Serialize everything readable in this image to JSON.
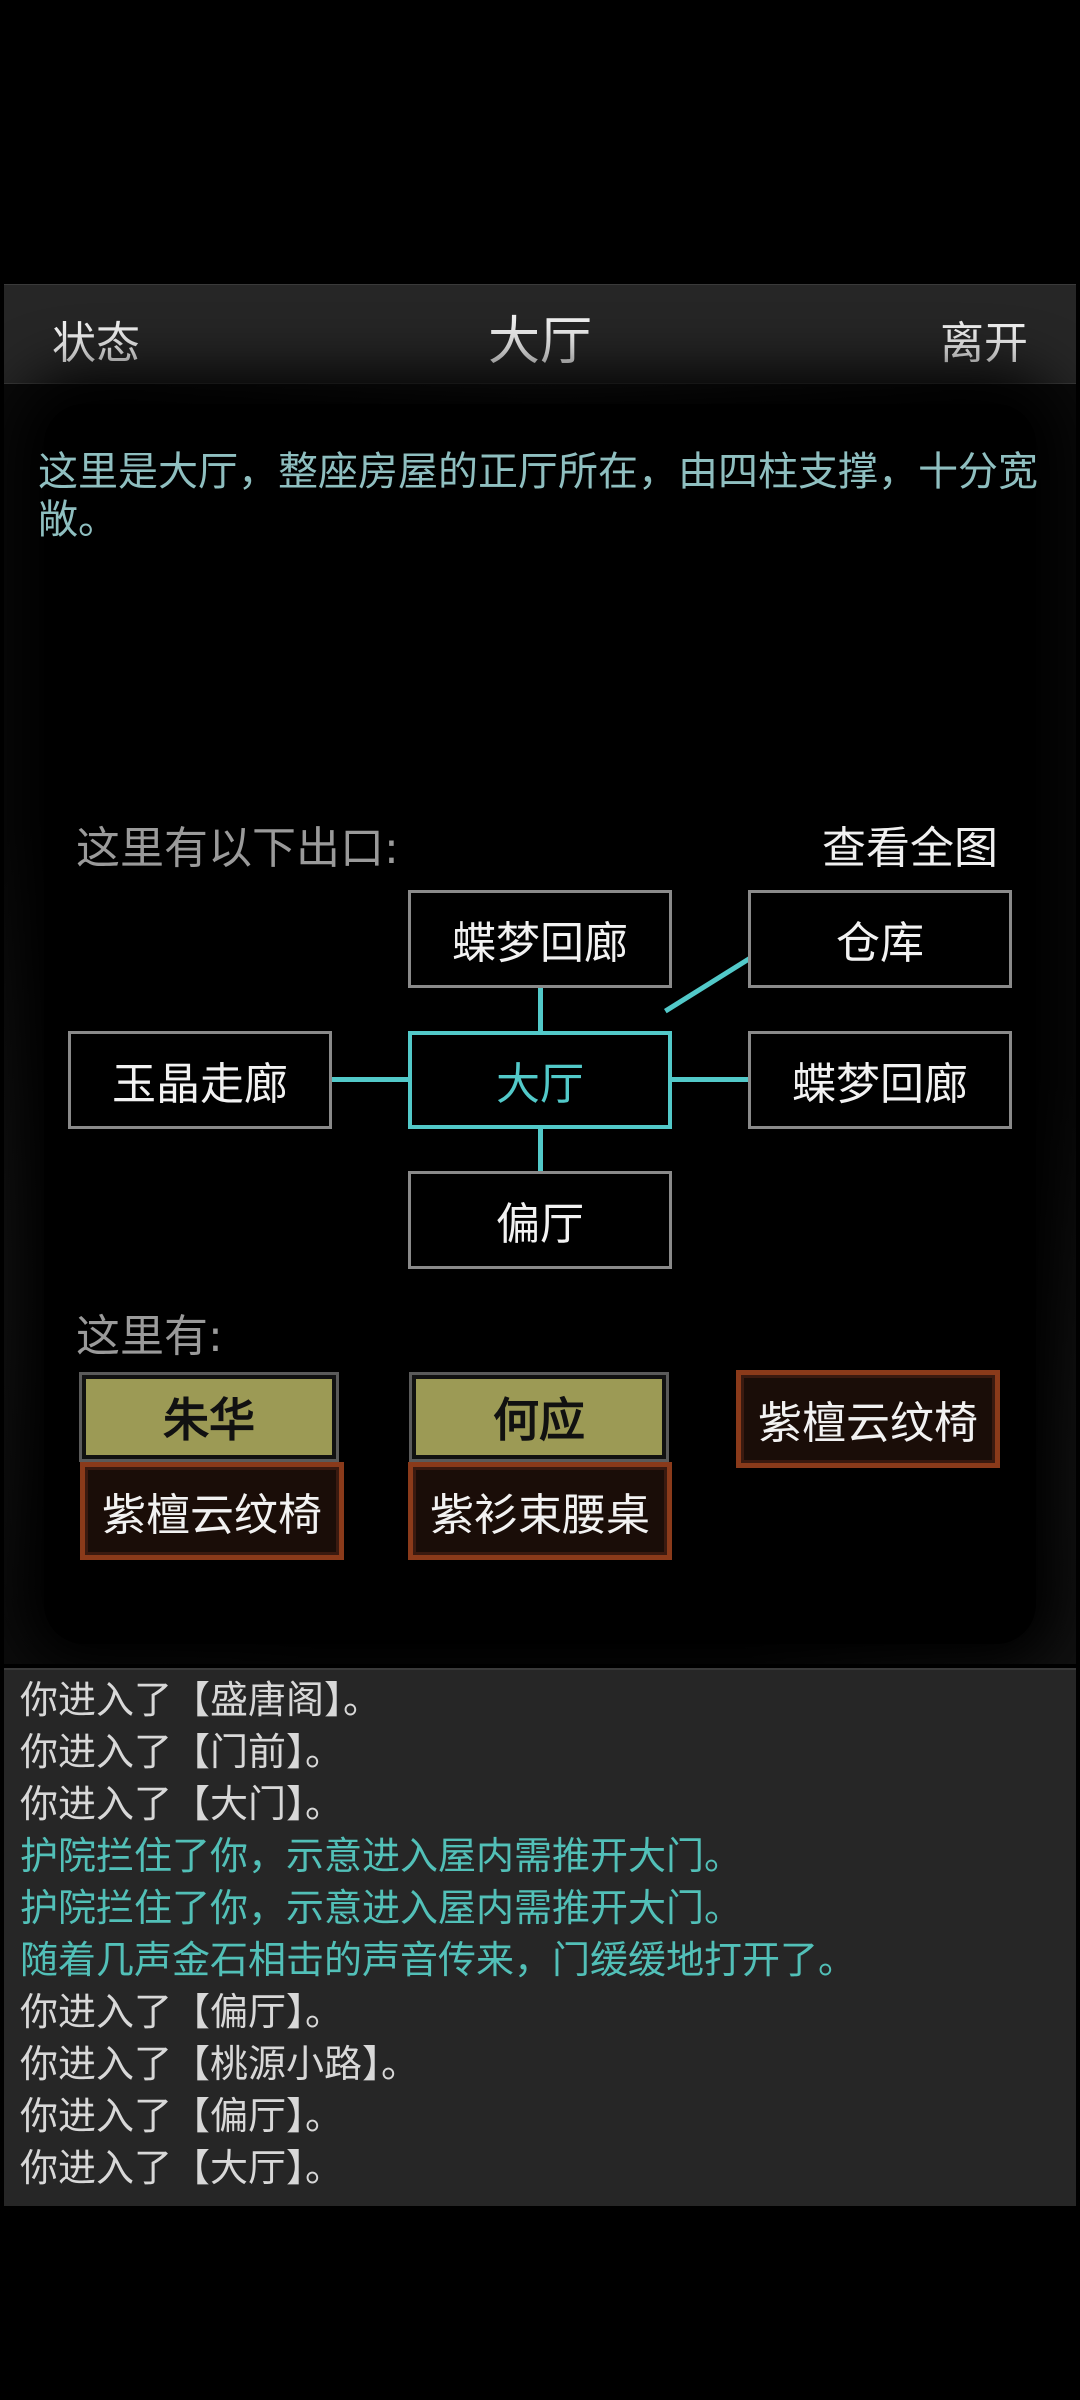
{
  "header": {
    "status_label": "状态",
    "title": "大厅",
    "leave_label": "离开"
  },
  "description": "这里是大厅，整座房屋的正厅所在，由四柱支撑，十分宽敞。",
  "exits": {
    "heading": "这里有以下出口:",
    "view_map_label": "查看全图",
    "north": "蝶梦回廊",
    "northeast": "仓库",
    "west": "玉晶走廊",
    "center": "大厅",
    "east": "蝶梦回廊",
    "south": "偏厅"
  },
  "present": {
    "heading": "这里有:",
    "npcs": [
      {
        "name": "朱华",
        "seat": "紫檀云纹椅"
      },
      {
        "name": "何应",
        "seat": "紫衫束腰桌"
      }
    ],
    "furniture": "紫檀云纹椅"
  },
  "log": [
    {
      "text": "你进入了【盛唐阁】。",
      "type": "normal"
    },
    {
      "text": "你进入了【门前】。",
      "type": "normal"
    },
    {
      "text": "你进入了【大门】。",
      "type": "normal"
    },
    {
      "text": "护院拦住了你，示意进入屋内需推开大门。",
      "type": "event"
    },
    {
      "text": "护院拦住了你，示意进入屋内需推开大门。",
      "type": "event"
    },
    {
      "text": "随着几声金石相击的声音传来，门缓缓地打开了。",
      "type": "event"
    },
    {
      "text": "你进入了【偏厅】。",
      "type": "normal"
    },
    {
      "text": "你进入了【桃源小路】。",
      "type": "normal"
    },
    {
      "text": "你进入了【偏厅】。",
      "type": "normal"
    },
    {
      "text": "你进入了【大厅】。",
      "type": "normal"
    }
  ],
  "colors": {
    "accent_teal": "#52c9c9",
    "card_olive": "#9c9a55",
    "furniture_border": "#8a3a1a",
    "log_event": "#52c0b8"
  }
}
